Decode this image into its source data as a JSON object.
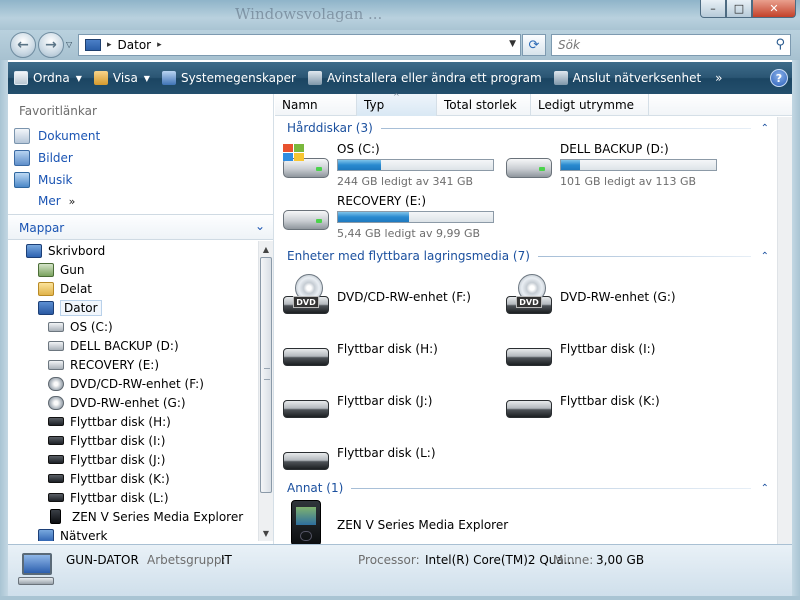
{
  "window": {
    "title_ghost": "Windowsvolagan ...",
    "min_glyph": "–",
    "max_glyph": "□",
    "close_glyph": "✕"
  },
  "address": {
    "root_sep": "▸",
    "crumb": "Dator",
    "crumb_sep": "▸",
    "search_placeholder": "Sök"
  },
  "toolbar": {
    "organize": "Ordna",
    "view": "Visa",
    "system_properties": "Systemegenskaper",
    "uninstall": "Avinstallera eller ändra ett program",
    "map_network": "Anslut nätverksenhet",
    "more": "»",
    "help": "?"
  },
  "favorites": {
    "title": "Favoritlänkar",
    "items": [
      {
        "label": "Dokument",
        "icon": "documents-icon"
      },
      {
        "label": "Bilder",
        "icon": "pictures-icon"
      },
      {
        "label": "Musik",
        "icon": "music-icon"
      }
    ],
    "more": "Mer",
    "more_chev": "»"
  },
  "folders": {
    "title": "Mappar",
    "chev": "⌄",
    "tree": [
      {
        "label": "Skrivbord",
        "icon": "desktop-icon",
        "level": 0
      },
      {
        "label": "Gun",
        "icon": "user-folder-icon",
        "level": 1
      },
      {
        "label": "Delat",
        "icon": "folder-icon",
        "level": 1
      },
      {
        "label": "Dator",
        "icon": "computer-icon",
        "level": 1,
        "selected": true
      },
      {
        "label": "OS (C:)",
        "icon": "hard-drive-icon",
        "level": 2
      },
      {
        "label": "DELL BACKUP (D:)",
        "icon": "hard-drive-icon",
        "level": 2
      },
      {
        "label": "RECOVERY (E:)",
        "icon": "hard-drive-icon",
        "level": 2
      },
      {
        "label": "DVD/CD-RW-enhet (F:)",
        "icon": "dvd-drive-icon",
        "level": 2
      },
      {
        "label": "DVD-RW-enhet (G:)",
        "icon": "dvd-drive-icon",
        "level": 2
      },
      {
        "label": "Flyttbar disk (H:)",
        "icon": "removable-disk-icon",
        "level": 2
      },
      {
        "label": "Flyttbar disk (I:)",
        "icon": "removable-disk-icon",
        "level": 2
      },
      {
        "label": "Flyttbar disk (J:)",
        "icon": "removable-disk-icon",
        "level": 2
      },
      {
        "label": "Flyttbar disk (K:)",
        "icon": "removable-disk-icon",
        "level": 2
      },
      {
        "label": "Flyttbar disk (L:)",
        "icon": "removable-disk-icon",
        "level": 2
      },
      {
        "label": "ZEN V Series Media Explorer",
        "icon": "media-player-icon",
        "level": 2
      },
      {
        "label": "Nätverk",
        "icon": "network-icon",
        "level": 1
      }
    ]
  },
  "columns": [
    "Namn",
    "Typ",
    "Total storlek",
    "Ledigt utrymme"
  ],
  "sort_glyph": "^",
  "groups": {
    "hdd": {
      "title": "Hårddiskar (3)",
      "collapse": "⌃"
    },
    "removable": {
      "title": "Enheter med flyttbara lagringsmedia (7)",
      "collapse": "⌃"
    },
    "other": {
      "title": "Annat (1)",
      "collapse": "⌃"
    }
  },
  "drives": [
    {
      "name": "OS (C:)",
      "free_text": "244 GB ledigt av 341 GB",
      "used_fraction": 0.28
    },
    {
      "name": "DELL BACKUP (D:)",
      "free_text": "101 GB ledigt av 113 GB",
      "used_fraction": 0.12
    },
    {
      "name": "RECOVERY (E:)",
      "free_text": "5,44 GB ledigt av 9,99 GB",
      "used_fraction": 0.46
    }
  ],
  "removable": [
    {
      "name": "DVD/CD-RW-enhet (F:)",
      "icon": "dvd-drive-icon"
    },
    {
      "name": "DVD-RW-enhet (G:)",
      "icon": "dvd-drive-icon"
    },
    {
      "name": "Flyttbar disk (H:)",
      "icon": "removable-disk-icon"
    },
    {
      "name": "Flyttbar disk (I:)",
      "icon": "removable-disk-icon"
    },
    {
      "name": "Flyttbar disk (J:)",
      "icon": "removable-disk-icon"
    },
    {
      "name": "Flyttbar disk (K:)",
      "icon": "removable-disk-icon"
    },
    {
      "name": "Flyttbar disk (L:)",
      "icon": "removable-disk-icon"
    }
  ],
  "dvd_label": "DVD",
  "other": [
    {
      "name": "ZEN V Series Media Explorer",
      "icon": "media-player-icon"
    }
  ],
  "details": {
    "computer_name": "GUN-DATOR",
    "workgroup_label": "Arbetsgrupp:",
    "workgroup": "IT",
    "processor_label": "Processor:",
    "processor": "Intel(R) Core(TM)2 Qua...",
    "memory_label": "Minne:",
    "memory": "3,00 GB"
  },
  "colors": {
    "link": "#1a54b3",
    "group_header": "#1a4f9e",
    "toolbar": "#2b5674",
    "progress": "#2a8ad0"
  }
}
